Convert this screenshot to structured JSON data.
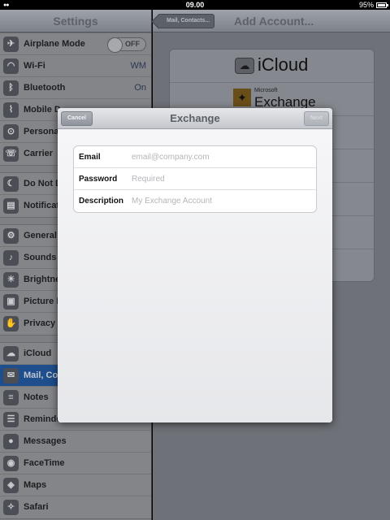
{
  "status_bar": {
    "time": "09.00",
    "battery": "95%"
  },
  "sidebar": {
    "title": "Settings",
    "groups": [
      [
        {
          "label": "Airplane Mode",
          "icon": "airplane-icon",
          "toggle": "OFF"
        },
        {
          "label": "Wi-Fi",
          "icon": "wifi-icon",
          "value": "WM"
        },
        {
          "label": "Bluetooth",
          "icon": "bluetooth-icon",
          "value": "On"
        },
        {
          "label": "Mobile D",
          "icon": "mobile-data-icon"
        },
        {
          "label": "Persona",
          "icon": "personal-hotspot-icon"
        },
        {
          "label": "Carrier",
          "icon": "carrier-icon"
        }
      ],
      [
        {
          "label": "Do Not D",
          "icon": "do-not-disturb-icon"
        },
        {
          "label": "Notificat",
          "icon": "notifications-icon"
        }
      ],
      [
        {
          "label": "General",
          "icon": "general-icon"
        },
        {
          "label": "Sounds",
          "icon": "sounds-icon"
        },
        {
          "label": "Brightne",
          "icon": "brightness-icon"
        },
        {
          "label": "Picture F",
          "icon": "picture-frame-icon"
        },
        {
          "label": "Privacy",
          "icon": "privacy-icon"
        }
      ],
      [
        {
          "label": "iCloud",
          "icon": "icloud-icon"
        },
        {
          "label": "Mail, Co",
          "icon": "mail-icon",
          "selected": true
        },
        {
          "label": "Notes",
          "icon": "notes-icon"
        },
        {
          "label": "Reminde",
          "icon": "reminders-icon"
        },
        {
          "label": "Messages",
          "icon": "messages-icon"
        },
        {
          "label": "FaceTime",
          "icon": "facetime-icon"
        },
        {
          "label": "Maps",
          "icon": "maps-icon"
        },
        {
          "label": "Safari",
          "icon": "safari-icon"
        }
      ]
    ]
  },
  "detail": {
    "back_label": "Mail, Contacts...",
    "title": "Add Account...",
    "accounts": {
      "icloud": "iCloud",
      "exchange_small": "Microsoft",
      "exchange": "Exchange"
    }
  },
  "modal": {
    "title": "Exchange",
    "cancel_label": "Cancel",
    "next_label": "Next",
    "fields": [
      {
        "label": "Email",
        "placeholder": "email@company.com"
      },
      {
        "label": "Password",
        "placeholder": "Required"
      },
      {
        "label": "Description",
        "placeholder": "My Exchange Account"
      }
    ]
  }
}
